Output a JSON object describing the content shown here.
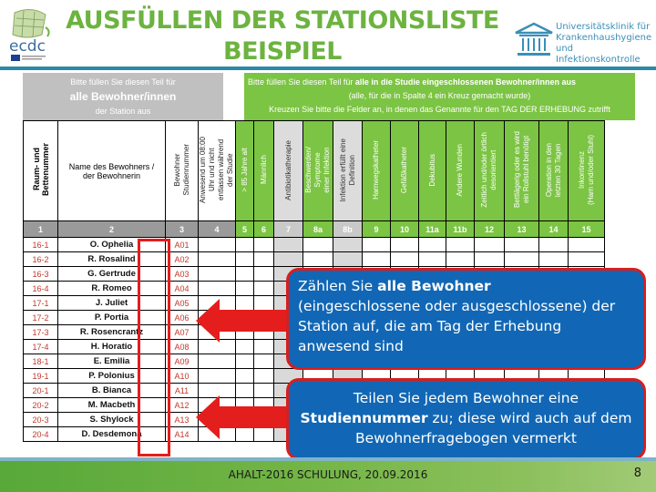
{
  "header": {
    "title_line1": "AUSFÜLLEN DER STATIONSLISTE",
    "title_line2": "BEISPIEL",
    "left_logo": {
      "icon": "ecdc-logo-icon",
      "text": "ecdc"
    },
    "right_logo": {
      "icon": "university-building-icon",
      "lines": [
        "Universitätsklinik für",
        "Krankenhaushygiene",
        "und Infektionskontrolle"
      ]
    }
  },
  "sheet": {
    "gray_banner": {
      "line1": "Bitte füllen Sie diesen Teil für",
      "line2": "alle Bewohner/innen",
      "line3": "der Station aus"
    },
    "green_banner": {
      "line1_prefix": "Bitte füllen Sie diesen Teil für ",
      "line1_bold": "alle in die Studie eingeschlossenen Bewohner/innen aus",
      "line2": "(alle, für die in Spalte 4 ein Kreuz gemacht wurde)",
      "line3": "Kreuzen Sie bitte die Felder an, in denen das Genannte für den TAG DER ERHEBUNG zutrifft"
    },
    "columns": [
      {
        "num": "1",
        "header": "Raum- und\nBettenummer",
        "style": "gray",
        "vertical": true,
        "bold": true
      },
      {
        "num": "2",
        "header": "Name des Bewohners /\nder Bewohnerin",
        "style": "gray",
        "vertical": false
      },
      {
        "num": "3",
        "header": "Bewohner\nStudiennummer",
        "style": "gray",
        "vertical": true
      },
      {
        "num": "4",
        "header": "Anwesend um 08:00\nUhr und nicht\nentlassen während\nder Studie",
        "style": "gray",
        "vertical": true
      },
      {
        "num": "5",
        "header": "> 85 Jahre alt",
        "style": "green",
        "vertical": true
      },
      {
        "num": "6",
        "header": "Männlich",
        "style": "green",
        "vertical": true
      },
      {
        "num": "7",
        "header": "Antibiotikatherapie",
        "style": "lgray",
        "vertical": true
      },
      {
        "num": "8a",
        "header": "Beschwerden/\nSymptome\neiner Infektion",
        "style": "green",
        "vertical": true
      },
      {
        "num": "8b",
        "header": "Infektion erfüllt eine\nDefinition",
        "style": "lgray",
        "vertical": true
      },
      {
        "num": "9",
        "header": "Harnwegskatheter",
        "style": "green",
        "vertical": true
      },
      {
        "num": "10",
        "header": "Gefäßkatheter",
        "style": "green",
        "vertical": true
      },
      {
        "num": "11a",
        "header": "Dekubitus",
        "style": "green",
        "vertical": true
      },
      {
        "num": "11b",
        "header": "Andere Wunden",
        "style": "green",
        "vertical": true
      },
      {
        "num": "12",
        "header": "Zeitlich und/oder örtlich\ndesorientiert",
        "style": "green",
        "vertical": true
      },
      {
        "num": "13",
        "header": "Bettlägerig oder es wird\nein Rollstuhl benötigt",
        "style": "green",
        "vertical": true
      },
      {
        "num": "14",
        "header": "Operation in den\nletzten 30 Tagen",
        "style": "green",
        "vertical": true
      },
      {
        "num": "15",
        "header": "Inkontinenz\n(Harn und/oder Stuhl)",
        "style": "green",
        "vertical": true
      }
    ],
    "rows": [
      {
        "room": "16-1",
        "name": "O. Ophelia",
        "id": "A01"
      },
      {
        "room": "16-2",
        "name": "R. Rosalind",
        "id": "A02"
      },
      {
        "room": "16-3",
        "name": "G. Gertrude",
        "id": "A03"
      },
      {
        "room": "16-4",
        "name": "R. Romeo",
        "id": "A04"
      },
      {
        "room": "17-1",
        "name": "J. Juliet",
        "id": "A05"
      },
      {
        "room": "17-2",
        "name": "P. Portia",
        "id": "A06"
      },
      {
        "room": "17-3",
        "name": "R. Rosencrantz",
        "id": "A07"
      },
      {
        "room": "17-4",
        "name": "H. Horatio",
        "id": "A08"
      },
      {
        "room": "18-1",
        "name": "E. Emilia",
        "id": "A09"
      },
      {
        "room": "19-1",
        "name": "P. Polonius",
        "id": "A10"
      },
      {
        "room": "20-1",
        "name": "B. Bianca",
        "id": "A11"
      },
      {
        "room": "20-2",
        "name": "M. Macbeth",
        "id": "A12"
      },
      {
        "room": "20-3",
        "name": "S. Shylock",
        "id": "A13"
      },
      {
        "room": "20-4",
        "name": "D. Desdemona",
        "id": "A14"
      }
    ]
  },
  "callouts": {
    "first": {
      "prefix": "Zählen Sie ",
      "bold": "alle Bewohner",
      "rest": "(eingeschlossene oder ausgeschlossene) der Station auf, die am Tag der Erhebung anwesend sind"
    },
    "second": {
      "line1": "Teilen Sie jedem Bewohner eine",
      "bold": "Studiennummer",
      "rest": " zu; diese wird auch auf dem Bewohnerfragebogen vermerkt"
    }
  },
  "colors": {
    "title_green": "#6cb33f",
    "header_green": "#7cc444",
    "callout_blue": "#1167b5",
    "callout_border_red": "#d81e1e",
    "highlight_red": "#e41d1d"
  },
  "footer": {
    "text": "AHALT-2016 SCHULUNG, 20.09.2016",
    "page_number": "8"
  }
}
